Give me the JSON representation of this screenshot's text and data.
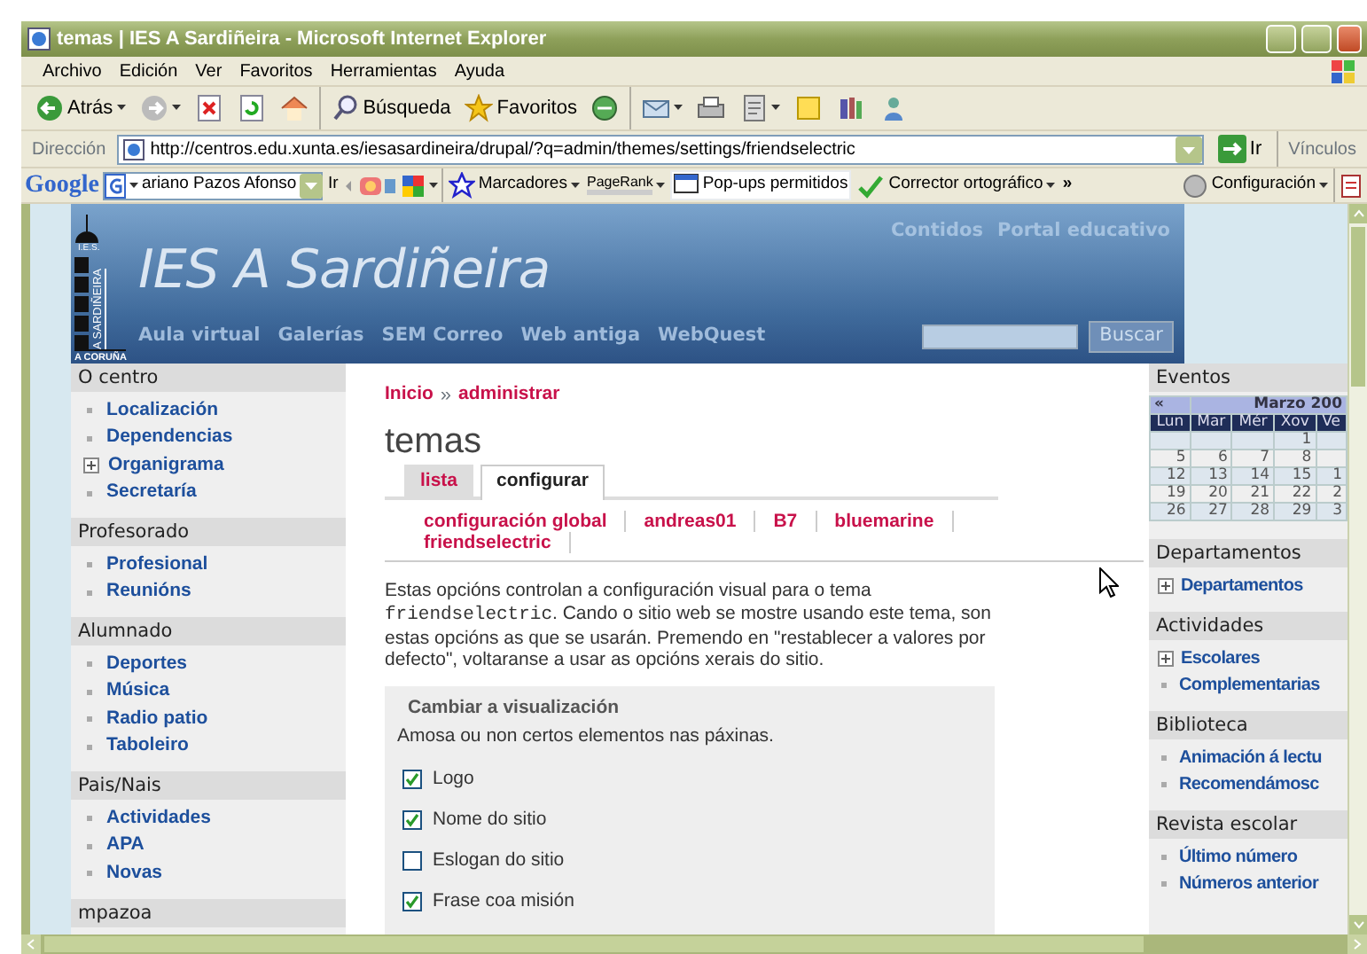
{
  "window": {
    "title": "temas | IES A Sardiñeira - Microsoft Internet Explorer"
  },
  "menu": [
    "Archivo",
    "Edición",
    "Ver",
    "Favoritos",
    "Herramientas",
    "Ayuda"
  ],
  "toolbar": [
    {
      "kind": "back",
      "label": "Atrás",
      "dropdown": true
    },
    {
      "kind": "forward",
      "dropdown": true
    },
    {
      "kind": "stop"
    },
    {
      "kind": "refresh"
    },
    {
      "kind": "home"
    },
    {
      "kind": "search",
      "label": "Búsqueda"
    },
    {
      "kind": "favorites",
      "label": "Favoritos"
    },
    {
      "kind": "media"
    },
    {
      "kind": "mail",
      "dropdown": true
    },
    {
      "kind": "print"
    },
    {
      "kind": "edit",
      "dropdown": true
    },
    {
      "kind": "note"
    },
    {
      "kind": "research"
    },
    {
      "kind": "messenger"
    }
  ],
  "address_bar": {
    "label": "Dirección",
    "url": "http://centros.edu.xunta.es/iesasardineira/drupal/?q=admin/themes/settings/friendselectric",
    "go": "Ir",
    "links": "Vínculos"
  },
  "google_bar": {
    "logo": "Google",
    "search_value": "ariano Pazos Afonso",
    "go": "Ir",
    "bookmarks": "Marcadores",
    "pagerank": "PageRank",
    "popups": "Pop-ups permitidos",
    "spellcheck": "Corrector ortográfico",
    "more": "»",
    "settings": "Configuración"
  },
  "site": {
    "logo": {
      "top": "I.E.S.",
      "side": "A SARDIÑEIRA",
      "bottom": "A CORUÑA"
    },
    "name": "IES A Sardiñeira",
    "nav": [
      "Aula virtual",
      "Galerías",
      "SEM Correo",
      "Web antiga",
      "WebQuest"
    ],
    "top_links": [
      "Contidos",
      "Portal educativo"
    ],
    "search_button": "Buscar",
    "left_sidebar": [
      {
        "title": "O centro",
        "items": [
          {
            "label": "Localización",
            "kind": "leaf"
          },
          {
            "label": "Dependencias",
            "kind": "leaf"
          },
          {
            "label": "Organigrama",
            "kind": "collapsed"
          },
          {
            "label": "Secretaría",
            "kind": "leaf"
          }
        ]
      },
      {
        "title": "Profesorado",
        "items": [
          {
            "label": "Profesional",
            "kind": "leaf"
          },
          {
            "label": "Reunións",
            "kind": "leaf"
          }
        ]
      },
      {
        "title": "Alumnado",
        "items": [
          {
            "label": "Deportes",
            "kind": "leaf"
          },
          {
            "label": "Música",
            "kind": "leaf"
          },
          {
            "label": "Radio patio",
            "kind": "leaf"
          },
          {
            "label": "Taboleiro",
            "kind": "leaf"
          }
        ]
      },
      {
        "title": "Pais/Nais",
        "items": [
          {
            "label": "Actividades",
            "kind": "leaf"
          },
          {
            "label": "APA",
            "kind": "leaf"
          },
          {
            "label": "Novas",
            "kind": "leaf"
          }
        ]
      },
      {
        "title": "mpazoa"
      }
    ],
    "main": {
      "breadcrumb": [
        "Inicio",
        "administrar"
      ],
      "breadcrumb_separator": "»",
      "title": "temas",
      "tabs": [
        {
          "label": "lista",
          "selected": false
        },
        {
          "label": "configurar",
          "selected": true
        }
      ],
      "subtabs": [
        "configuración global",
        "andreas01",
        "B7",
        "bluemarine",
        "friendselectric"
      ],
      "description": {
        "before": "Estas opcións controlan a configuración visual para o tema ",
        "code": "friendselectric",
        "after": ". Cando o sitio web se mostre usando este tema, son estas opcións as que se usarán. Premendo en \"restablecer a valores por defecto\", voltaranse a usar as opcións xerais do sitio."
      },
      "fieldset": {
        "legend": "Cambiar a visualización",
        "description": "Amosa ou non certos elementos nas páxinas.",
        "options": [
          {
            "label": "Logo",
            "checked": true
          },
          {
            "label": "Nome do sitio",
            "checked": true
          },
          {
            "label": "Eslogan do sitio",
            "checked": false
          },
          {
            "label": "Frase coa misión",
            "checked": true
          }
        ]
      }
    },
    "right_sidebar": {
      "events_title": "Eventos",
      "calendar": {
        "prev": "«",
        "month": "Marzo 200",
        "weekdays": [
          "Lun",
          "Mar",
          "Mér",
          "Xov",
          "Ve"
        ],
        "weeks": [
          [
            {
              "blank": true
            },
            {
              "blank": true
            },
            {
              "blank": true
            },
            {
              "day": "1"
            },
            {
              "blank": true
            }
          ],
          [
            {
              "day": "5"
            },
            {
              "day": "6"
            },
            {
              "day": "7"
            },
            {
              "day": "8"
            },
            {
              "blank": true
            }
          ],
          [
            {
              "day": "12"
            },
            {
              "day": "13"
            },
            {
              "day": "14"
            },
            {
              "day": "15"
            },
            {
              "day": "1"
            }
          ],
          [
            {
              "day": "19"
            },
            {
              "day": "20"
            },
            {
              "day": "21"
            },
            {
              "day": "22"
            },
            {
              "day": "2"
            }
          ],
          [
            {
              "day": "26"
            },
            {
              "day": "27"
            },
            {
              "day": "28"
            },
            {
              "day": "29"
            },
            {
              "day": "3"
            }
          ]
        ]
      },
      "blocks": [
        {
          "title": "Departamentos",
          "items": [
            {
              "label": "Departamentos",
              "kind": "collapsed"
            }
          ]
        },
        {
          "title": "Actividades",
          "items": [
            {
              "label": "Escolares",
              "kind": "collapsed"
            },
            {
              "label": "Complementarias",
              "kind": "leaf"
            }
          ]
        },
        {
          "title": "Biblioteca",
          "items": [
            {
              "label": "Animación á lectu",
              "kind": "leaf"
            },
            {
              "label": "Recomendámosc",
              "kind": "leaf"
            }
          ]
        },
        {
          "title": "Revista escolar",
          "items": [
            {
              "label": "Último número",
              "kind": "leaf"
            },
            {
              "label": "Números anterior",
              "kind": "leaf"
            }
          ]
        }
      ]
    }
  }
}
